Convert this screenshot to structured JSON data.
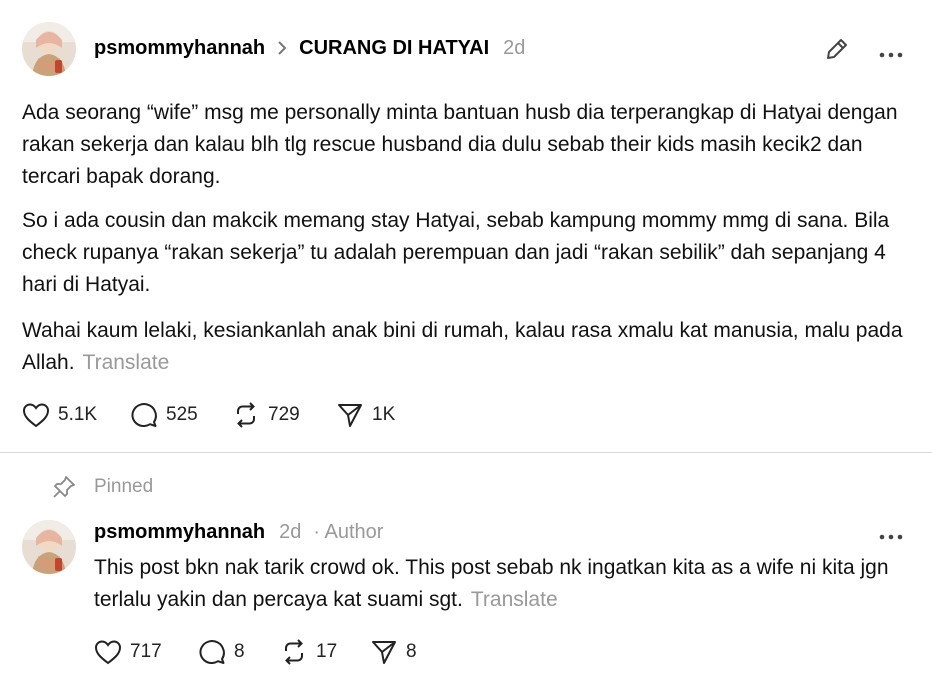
{
  "post": {
    "username": "psmommyhannah",
    "topic": "CURANG DI HATYAI",
    "time": "2d",
    "paragraphs": [
      "Ada seorang “wife” msg me personally minta bantuan husb dia terperangkap di Hatyai dengan rakan sekerja dan kalau blh tlg rescue husband dia dulu sebab their kids masih kecik2 dan tercari bapak dorang.",
      "So i ada cousin dan makcik memang stay Hatyai, sebab kampung mommy mmg di sana. Bila check rupanya “rakan sekerja” tu adalah perempuan dan jadi “rakan sebilik” dah sepanjang 4 hari di Hatyai.",
      "Wahai kaum lelaki, kesiankanlah anak bini di rumah, kalau rasa xmalu kat manusia, malu pada Allah."
    ],
    "translate_label": "Translate",
    "likes": "5.1K",
    "replies": "525",
    "reposts": "729",
    "shares": "1K"
  },
  "reply": {
    "pinned_label": "Pinned",
    "username": "psmommyhannah",
    "time": "2d",
    "author_label": "· Author",
    "text": "This post bkn nak tarik crowd ok. This post sebab nk ingatkan kita as a wife ni kita jgn terlalu yakin dan percaya kat suami sgt.",
    "translate_label": "Translate",
    "likes": "717",
    "replies": "8",
    "reposts": "17",
    "shares": "8"
  },
  "icons": [
    "chevron-right-icon",
    "edit-icon",
    "more-icon",
    "heart-icon",
    "comment-icon",
    "repost-icon",
    "share-icon",
    "pin-icon"
  ],
  "colors": {
    "muted": "#999999",
    "divider": "#d9d9d9",
    "text": "#111111"
  }
}
